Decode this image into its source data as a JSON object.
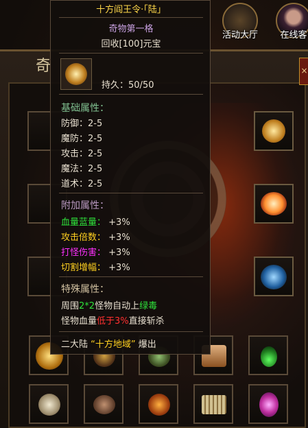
{
  "window": {
    "title_char": "奇",
    "close_label": "×"
  },
  "top_buttons": [
    {
      "label": "活动大厅",
      "icon": "golden-warrior-icon"
    },
    {
      "label": "在线客",
      "icon": "female-avatar-icon"
    }
  ],
  "tooltip": {
    "title": "十方阎王令·「陆」",
    "subtitle": "奇物第一格",
    "recycle": "回收[100]元宝",
    "durability_label": "持久：",
    "durability_value": "50/50",
    "base_header": "基础属性：",
    "base_stats": [
      {
        "name": "防御：",
        "value": "2-5"
      },
      {
        "name": "魔防：",
        "value": "2-5"
      },
      {
        "name": "攻击：",
        "value": "2-5"
      },
      {
        "name": "魔法：",
        "value": "2-5"
      },
      {
        "name": "道术：",
        "value": "2-5"
      }
    ],
    "extra_header": "附加属性：",
    "extra_stats": [
      {
        "name": "血量蓝量：",
        "value": "+3%",
        "color": "#2ee03a"
      },
      {
        "name": "攻击倍数：",
        "value": "+3%",
        "color": "#ffd020"
      },
      {
        "name": "打怪伤害：",
        "value": "+3%",
        "color": "#ff30ff"
      },
      {
        "name": "切割增幅：",
        "value": "+3%",
        "color": "#ffd020"
      }
    ],
    "special_header": "特殊属性：",
    "special_line1": {
      "a": "周围",
      "b": "2*2",
      "c": "怪物自动上",
      "d": "绿毒"
    },
    "special_line2": {
      "a": "怪物血量",
      "b": "低于3%",
      "c": "直接斩杀"
    },
    "drop": {
      "a": "二大陆 ",
      "b": "“十方地域”",
      "c": " 爆出"
    }
  },
  "colors": {
    "title": "#ffd84a",
    "green": "#2ee03a",
    "yellow": "#ffd020",
    "magenta": "#ff30ff",
    "red": "#ff3030"
  }
}
